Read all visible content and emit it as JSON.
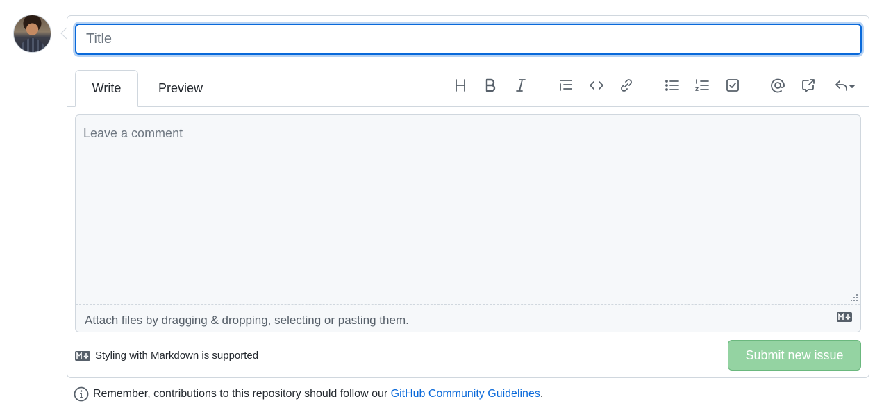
{
  "title_input": {
    "placeholder": "Title",
    "value": ""
  },
  "tabs": {
    "write": "Write",
    "preview": "Preview"
  },
  "toolbar": [
    {
      "name": "heading-icon",
      "label": "H"
    },
    {
      "name": "bold-icon",
      "label": "B"
    },
    {
      "name": "italic-icon",
      "label": "I"
    },
    {
      "name": "quote-icon",
      "label": ""
    },
    {
      "name": "code-icon",
      "label": ""
    },
    {
      "name": "link-icon",
      "label": ""
    },
    {
      "name": "bulleted-list-icon",
      "label": ""
    },
    {
      "name": "numbered-list-icon",
      "label": ""
    },
    {
      "name": "task-list-icon",
      "label": ""
    },
    {
      "name": "mention-icon",
      "label": ""
    },
    {
      "name": "cross-reference-icon",
      "label": ""
    },
    {
      "name": "reply-icon",
      "label": ""
    }
  ],
  "comment": {
    "placeholder": "Leave a comment",
    "attach_text": "Attach files by dragging & dropping, selecting or pasting them."
  },
  "footer": {
    "markdown_text": "Styling with Markdown is supported",
    "submit_label": "Submit new issue",
    "notice_prefix": "Remember, contributions to this repository should follow our ",
    "notice_link": "GitHub Community Guidelines",
    "notice_suffix": "."
  },
  "colors": {
    "accent": "#0969da",
    "submit_disabled": "#94d3a2",
    "border": "#d0d7de"
  }
}
